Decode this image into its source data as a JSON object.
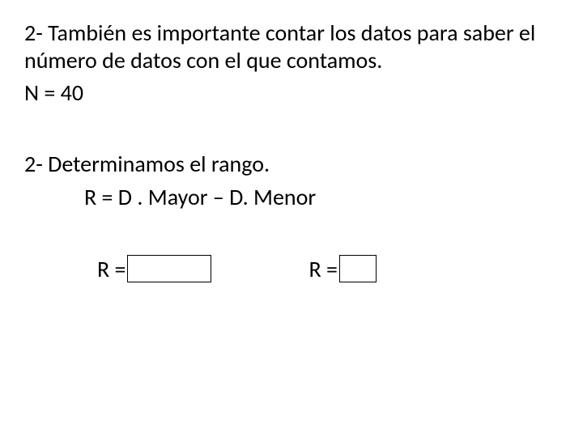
{
  "step1": {
    "text": "2- También es importante contar los datos para saber el número de datos con el que contamos.",
    "n_line": "N = 40"
  },
  "step2": {
    "title": "2- Determinamos el rango.",
    "formula": "R = D . Mayor – D. Menor",
    "eq1_label": "R = ",
    "eq2_label": "R = "
  }
}
